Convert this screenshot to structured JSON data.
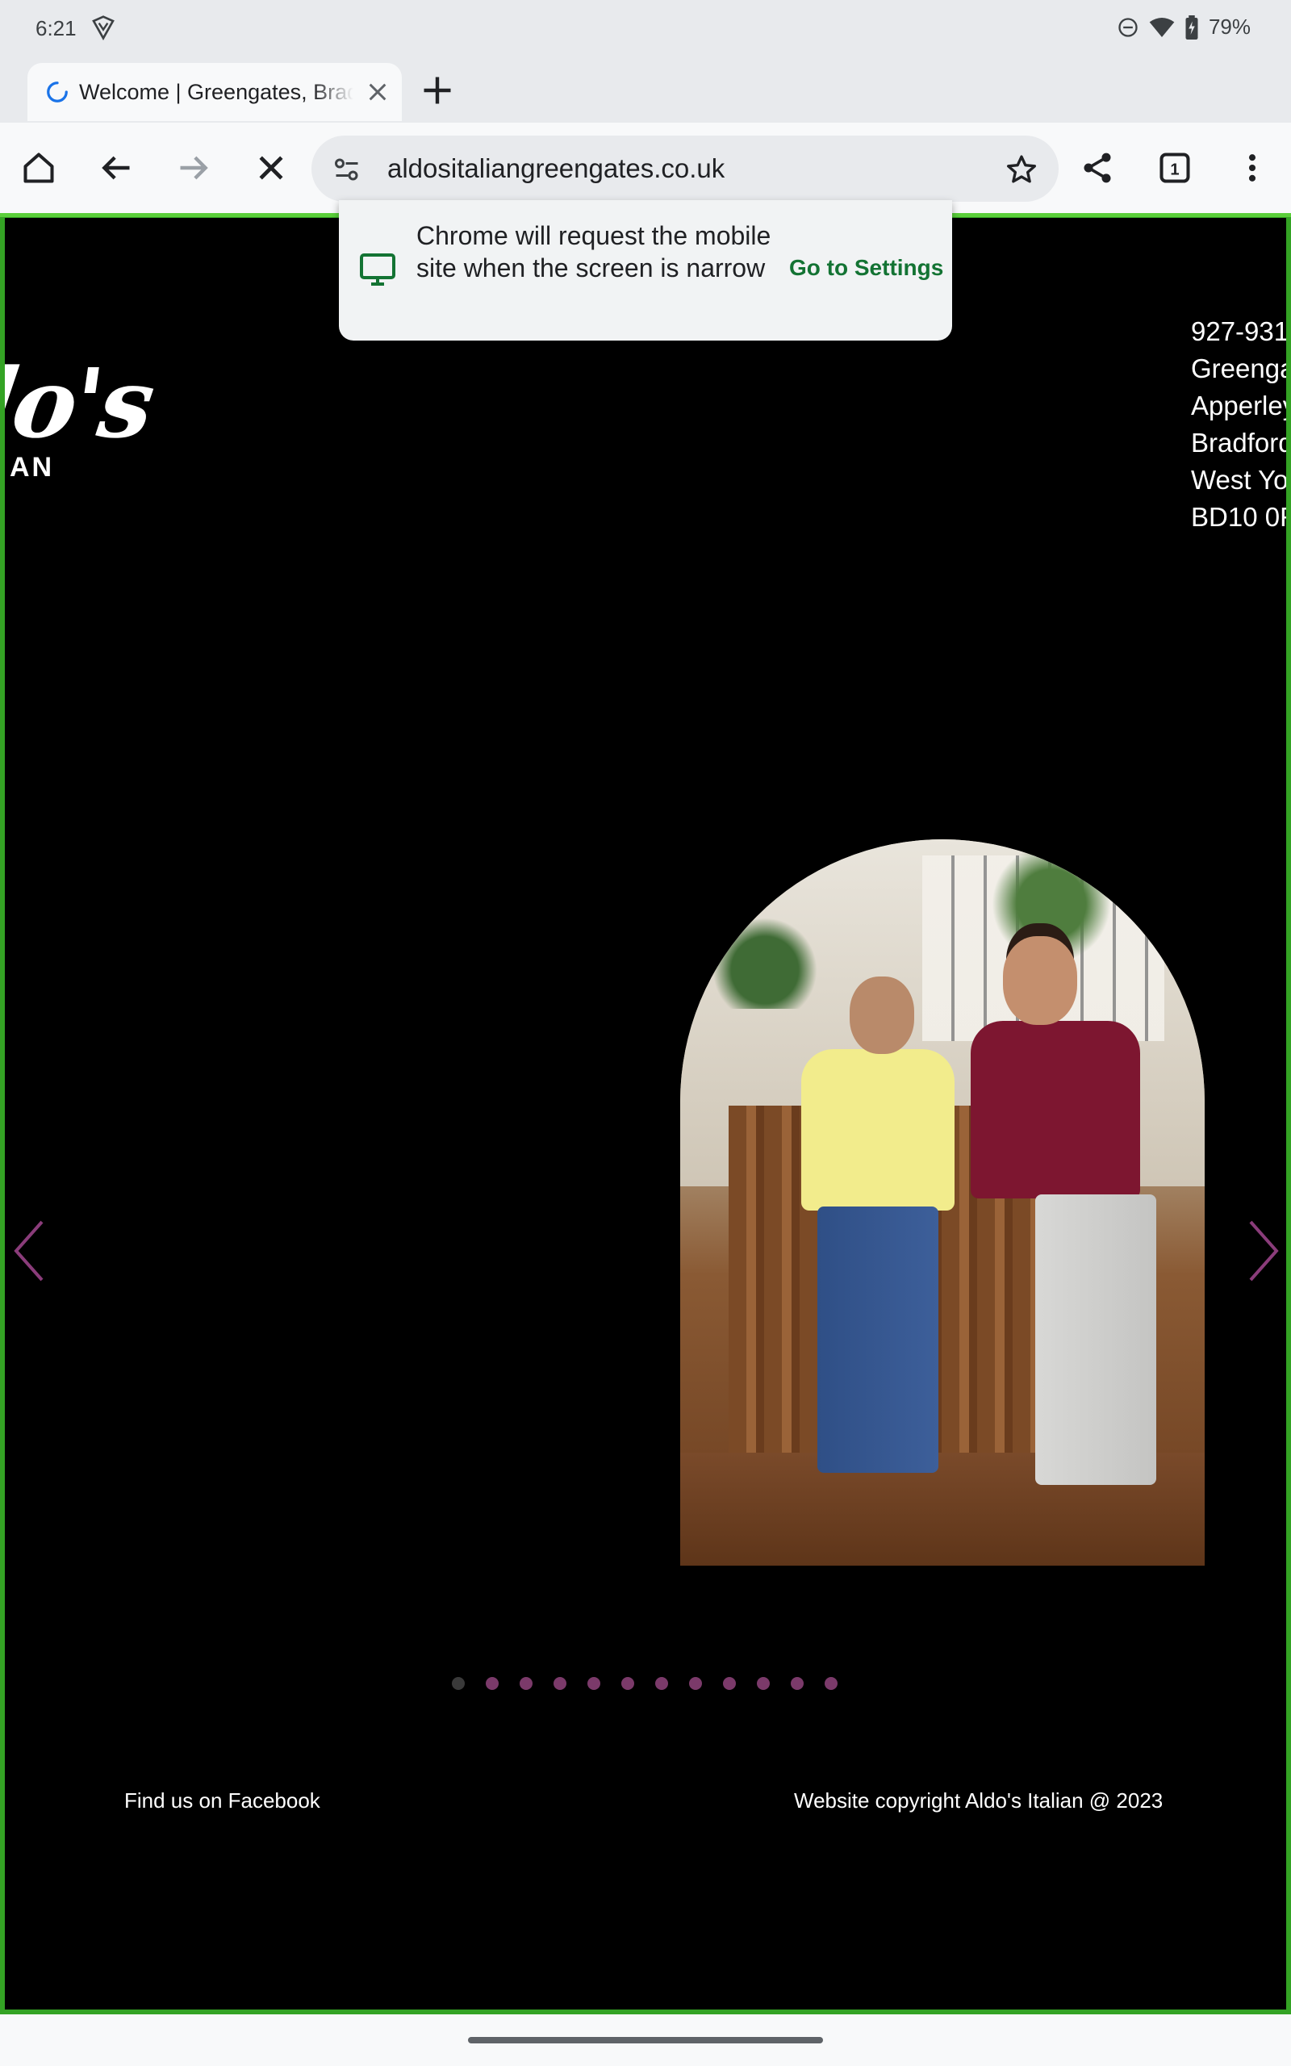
{
  "status_bar": {
    "time": "6:21",
    "battery": "79%",
    "icons": [
      "vpn-icon",
      "dnd-icon",
      "wifi-icon",
      "battery-icon"
    ]
  },
  "tabs": [
    {
      "title": "Welcome | Greengates, Bradford",
      "loading": true
    }
  ],
  "toolbar": {
    "url": "aldositaliangreengates.co.uk"
  },
  "infobar": {
    "message": "Chrome will request the mobile site when the screen is narrow",
    "action": "Go to Settings"
  },
  "site": {
    "logo_script": "lo's",
    "logo_sub": "AN",
    "address_lines": [
      "927-931",
      "Greenga",
      "Apperley",
      "Bradford",
      "West Yo",
      "BD10 0R"
    ],
    "slideshow": {
      "slide_count": 12,
      "active_index": 0
    },
    "footer_left": "Find us on Facebook",
    "footer_right": "Website copyright Aldo's Italian @ 2023"
  },
  "colors": {
    "accent_green": "#34a324",
    "dot_color": "#7b3a6a",
    "arrow_color": "#8a3c7a"
  }
}
